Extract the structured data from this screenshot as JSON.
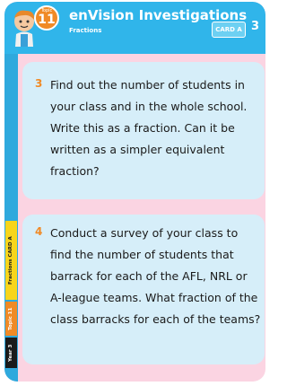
{
  "header": {
    "topic_word": "Topic",
    "topic_number": "11",
    "title": "enVision Investigations",
    "subtitle": "Fractions",
    "card_label": "CARD A",
    "card_number": "3"
  },
  "spine": {
    "grade": "Year 3",
    "topic": "Topic 11",
    "strand": "Fractions  CARD A"
  },
  "questions": [
    {
      "number": "3",
      "text": "Find out the number of students in your class and in the whole school. Write this as a fraction. Can it be written as a simpler equivalent fraction?"
    },
    {
      "number": "4",
      "text": "Conduct a survey of your class to find the number of students that barrack for each of the AFL, NRL or A-league teams. What fraction of the class barracks for each of the teams?"
    }
  ],
  "colors": {
    "header_blue": "#30b5ea",
    "panel_blue": "#d6eef9",
    "card_pink": "#fbd4e2",
    "accent_orange": "#f08a26",
    "accent_yellow": "#f8d51a"
  }
}
